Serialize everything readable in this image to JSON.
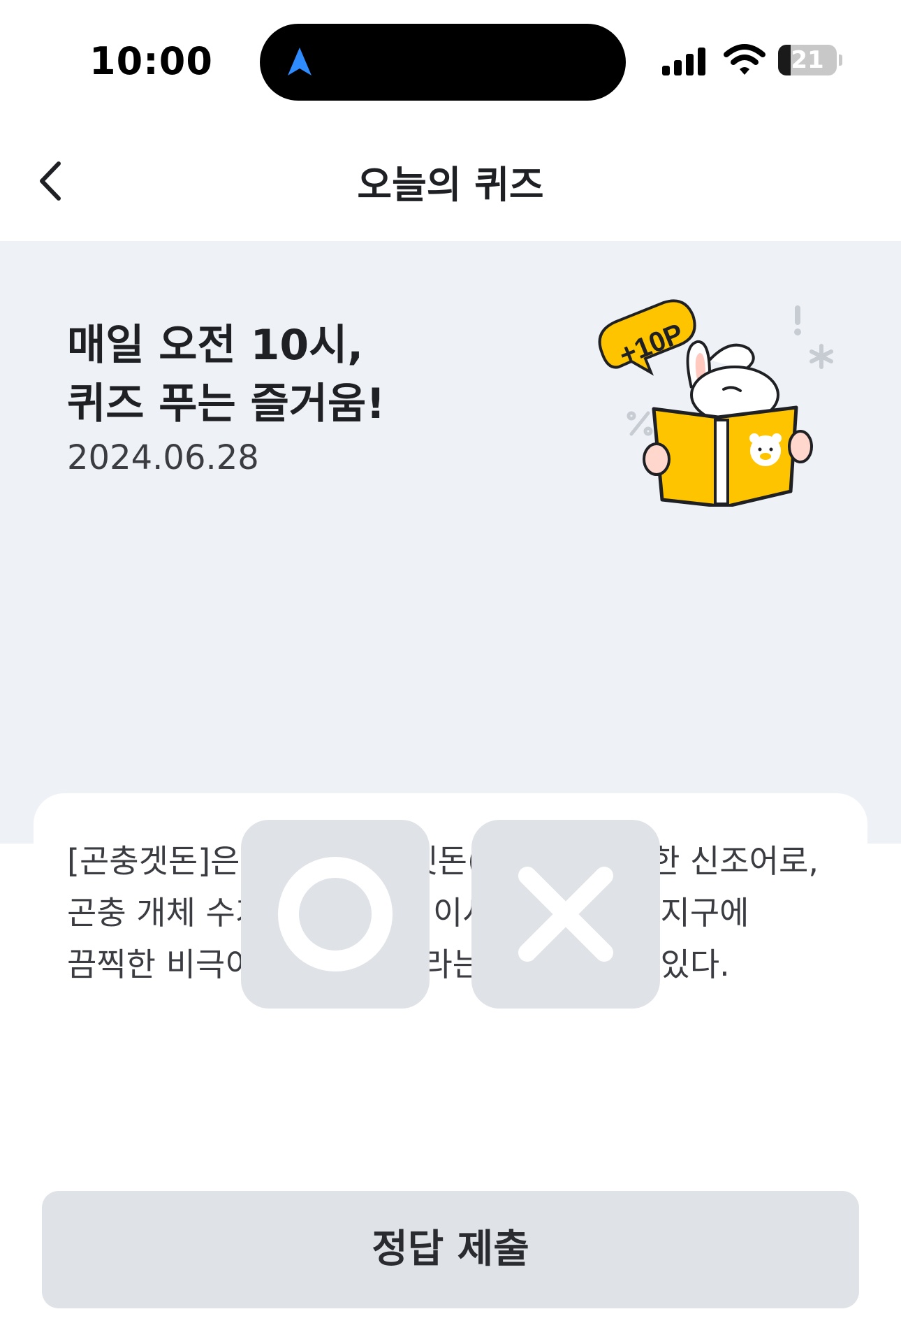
{
  "status_bar": {
    "time": "10:00",
    "battery_level": "21",
    "battery_fraction": 0.21
  },
  "header": {
    "title": "오늘의 퀴즈"
  },
  "hero": {
    "line1": "매일 오전 10시,",
    "line2": "퀴즈 푸는 즐거움!",
    "date": "2024.06.28",
    "badge": "+10P"
  },
  "quiz": {
    "question": "[곤충겟돈]은 곤충과 아마겟돈(종말)을 합성한 신조어로, 곤충 개체 수가 감소하면 먹이사슬이 무너져 지구에 끔찍한 비극이 일어날 것이라는 의미를 담고 있다.",
    "answers": [
      {
        "icon": "circle-o-icon",
        "selected": false
      },
      {
        "icon": "x-mark-icon",
        "selected": false
      }
    ]
  },
  "footer": {
    "submit_label": "정답 제출"
  },
  "colors": {
    "hero_bg": "#eef1f6",
    "button_bg": "#dfe2e6",
    "accent_yellow": "#ffc400",
    "nav_arrow_blue": "#2f8cff"
  }
}
